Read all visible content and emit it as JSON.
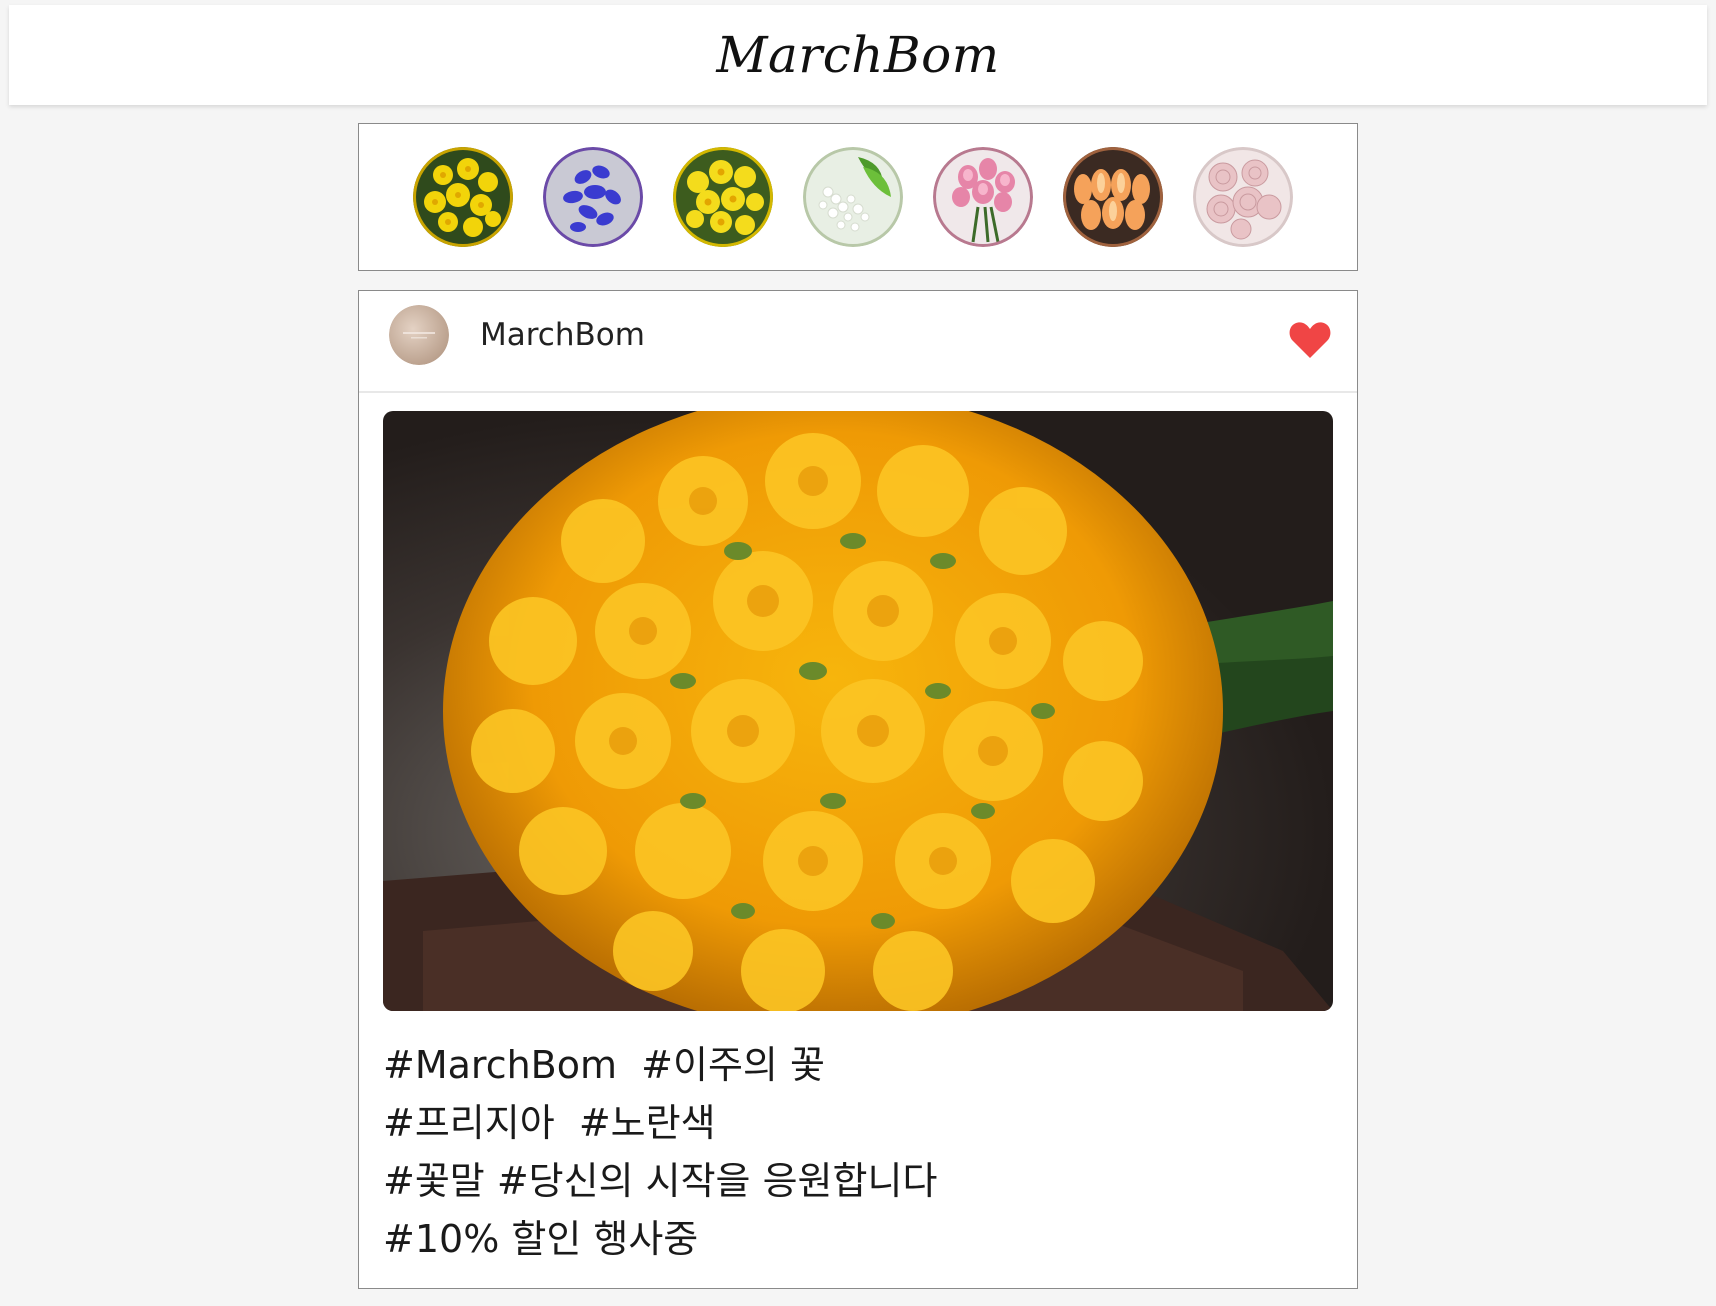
{
  "header": {
    "title": "MarchBom"
  },
  "stories": {
    "items": [
      {
        "icon": "daffodil-story-icon",
        "ring": "#c9a400",
        "bg": "#2f4a1c",
        "petal": "#f2d40a"
      },
      {
        "icon": "delphinium-story-icon",
        "ring": "#6b4aa8",
        "bg": "#c9c9d4",
        "petal": "#3a3bd0"
      },
      {
        "icon": "narcissus-story-icon",
        "ring": "#d4b800",
        "bg": "#3d5c1e",
        "petal": "#f4dc1c"
      },
      {
        "icon": "white-flower-story-icon",
        "ring": "#b8c8a8",
        "bg": "#e8efe4",
        "petal": "#ffffff"
      },
      {
        "icon": "lisianthus-story-icon",
        "ring": "#b8798f",
        "bg": "#f0e8ea",
        "petal": "#e685a8"
      },
      {
        "icon": "tulip-story-icon",
        "ring": "#a0623e",
        "bg": "#3b2a22",
        "petal": "#f5a25a"
      },
      {
        "icon": "ranunculus-story-icon",
        "ring": "#d8c8c8",
        "bg": "#f1e6e6",
        "petal": "#e9c3c6"
      }
    ]
  },
  "post": {
    "username": "MarchBom",
    "avatar_icon": "brand-avatar-icon",
    "like_icon": "heart-icon",
    "like_color": "#f04545",
    "photo_icon": "freesia-bouquet-image",
    "caption_lines": [
      "#MarchBom  #이주의 꽃",
      "#프리지아  #노란색",
      "#꽃말 #당신의 시작을 응원합니다",
      "#10% 할인 행사중"
    ]
  }
}
